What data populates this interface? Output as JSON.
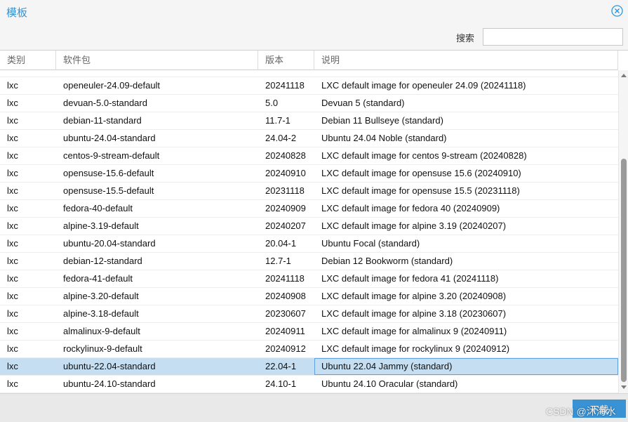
{
  "window": {
    "title": "模板",
    "close_icon": "close-circle-icon"
  },
  "toolbar": {
    "search_label": "搜索",
    "search_value": "",
    "search_placeholder": ""
  },
  "table": {
    "columns": [
      "类别",
      "软件包",
      "版本",
      "说明"
    ],
    "partial_top_row": {
      "type": "",
      "package": "",
      "version": "",
      "description": ""
    },
    "rows": [
      {
        "type": "lxc",
        "package": "openeuler-24.09-default",
        "version": "20241118",
        "description": "LXC default image for openeuler 24.09 (20241118)"
      },
      {
        "type": "lxc",
        "package": "devuan-5.0-standard",
        "version": "5.0",
        "description": "Devuan 5 (standard)"
      },
      {
        "type": "lxc",
        "package": "debian-11-standard",
        "version": "11.7-1",
        "description": "Debian 11 Bullseye (standard)"
      },
      {
        "type": "lxc",
        "package": "ubuntu-24.04-standard",
        "version": "24.04-2",
        "description": "Ubuntu 24.04 Noble (standard)"
      },
      {
        "type": "lxc",
        "package": "centos-9-stream-default",
        "version": "20240828",
        "description": "LXC default image for centos 9-stream (20240828)"
      },
      {
        "type": "lxc",
        "package": "opensuse-15.6-default",
        "version": "20240910",
        "description": "LXC default image for opensuse 15.6 (20240910)"
      },
      {
        "type": "lxc",
        "package": "opensuse-15.5-default",
        "version": "20231118",
        "description": "LXC default image for opensuse 15.5 (20231118)"
      },
      {
        "type": "lxc",
        "package": "fedora-40-default",
        "version": "20240909",
        "description": "LXC default image for fedora 40 (20240909)"
      },
      {
        "type": "lxc",
        "package": "alpine-3.19-default",
        "version": "20240207",
        "description": "LXC default image for alpine 3.19 (20240207)"
      },
      {
        "type": "lxc",
        "package": "ubuntu-20.04-standard",
        "version": "20.04-1",
        "description": "Ubuntu Focal (standard)"
      },
      {
        "type": "lxc",
        "package": "debian-12-standard",
        "version": "12.7-1",
        "description": "Debian 12 Bookworm (standard)"
      },
      {
        "type": "lxc",
        "package": "fedora-41-default",
        "version": "20241118",
        "description": "LXC default image for fedora 41 (20241118)"
      },
      {
        "type": "lxc",
        "package": "alpine-3.20-default",
        "version": "20240908",
        "description": "LXC default image for alpine 3.20 (20240908)"
      },
      {
        "type": "lxc",
        "package": "alpine-3.18-default",
        "version": "20230607",
        "description": "LXC default image for alpine 3.18 (20230607)"
      },
      {
        "type": "lxc",
        "package": "almalinux-9-default",
        "version": "20240911",
        "description": "LXC default image for almalinux 9 (20240911)"
      },
      {
        "type": "lxc",
        "package": "rockylinux-9-default",
        "version": "20240912",
        "description": "LXC default image for rockylinux 9 (20240912)"
      },
      {
        "type": "lxc",
        "package": "ubuntu-22.04-standard",
        "version": "22.04-1",
        "description": "Ubuntu 22.04 Jammy (standard)",
        "selected": true
      },
      {
        "type": "lxc",
        "package": "ubuntu-24.10-standard",
        "version": "24.10-1",
        "description": "Ubuntu 24.10 Oracular (standard)"
      }
    ]
  },
  "footer": {
    "download_label": "下载",
    "watermark": "CSDN @沐海水"
  },
  "colors": {
    "accent": "#3892d4",
    "selected_row": "#c5def2"
  }
}
